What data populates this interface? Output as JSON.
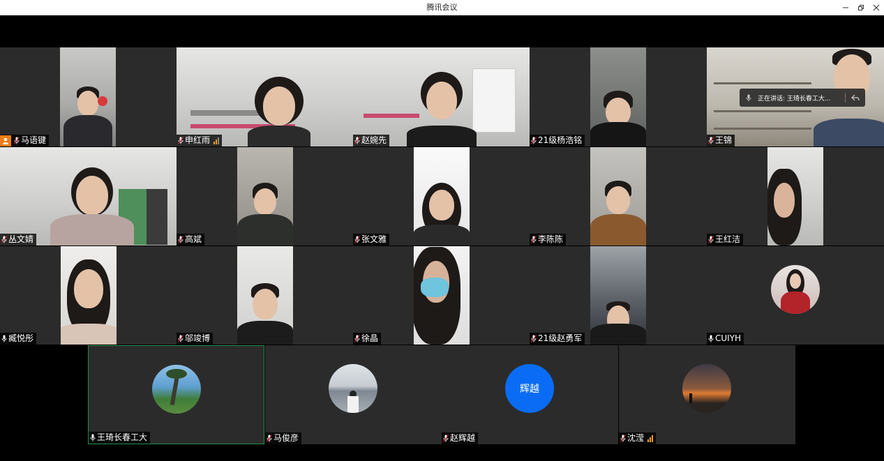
{
  "window": {
    "title": "腾讯会议"
  },
  "speaking_toast": {
    "text": "正在讲话: 王琦长春工大..."
  },
  "participants": [
    {
      "name": "马语键",
      "is_host": true
    },
    {
      "name": "申红雨",
      "signal": true
    },
    {
      "name": "赵婉先"
    },
    {
      "name": "21级杨浩铭"
    },
    {
      "name": "王锦"
    },
    {
      "name": "丛文婧"
    },
    {
      "name": "高斌"
    },
    {
      "name": "张文雅"
    },
    {
      "name": "李陈陈"
    },
    {
      "name": "王红洁"
    },
    {
      "name": "臧悦彤"
    },
    {
      "name": "邬竣博"
    },
    {
      "name": "徐晶"
    },
    {
      "name": "21级赵勇军"
    },
    {
      "name": "CUIYH",
      "video": false
    },
    {
      "name": "王琦长春工大",
      "video": false,
      "speaking": true
    },
    {
      "name": "马俊彦",
      "video": false
    },
    {
      "name": "赵辉越",
      "video": false,
      "avatar_text": "辉越"
    },
    {
      "name": "沈滢",
      "video": false,
      "signal": true
    }
  ],
  "colors": {
    "speaking_border": "#1f8f4a",
    "host_badge": "#f07d17",
    "signal": "#f59b23",
    "text_avatar": "#0a6cf5"
  }
}
